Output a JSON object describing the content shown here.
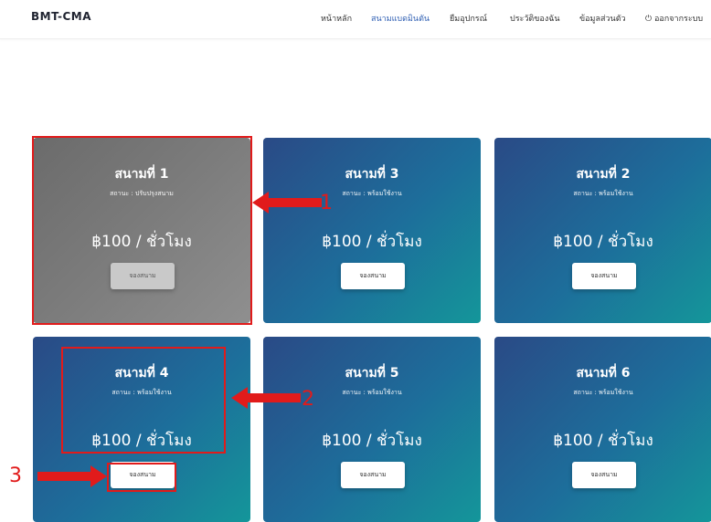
{
  "nav": {
    "brand": "BMT-CMA",
    "links": [
      {
        "label": "หน้าหลัก",
        "active": false
      },
      {
        "label": "สนามแบดมินตัน",
        "active": true
      },
      {
        "label": "ยืมอุปกรณ์",
        "active": false
      },
      {
        "label": "ประวัติของฉัน",
        "active": false
      },
      {
        "label": "ข้อมูลส่วนตัว",
        "active": false
      },
      {
        "label": "⏻ ออกจากระบบ",
        "active": false
      }
    ]
  },
  "courts": [
    {
      "name": "สนามที่ 1",
      "status": "สถานะ : ปรับปรุงสนาม",
      "price": "฿100 / ชั่วโมง",
      "button": "จองสนาม"
    },
    {
      "name": "สนามที่ 3",
      "status": "สถานะ : พร้อมใช้งาน",
      "price": "฿100 / ชั่วโมง",
      "button": "จองสนาม"
    },
    {
      "name": "สนามที่ 2",
      "status": "สถานะ : พร้อมใช้งาน",
      "price": "฿100 / ชั่วโมง",
      "button": "จองสนาม"
    },
    {
      "name": "สนามที่ 4",
      "status": "สถานะ : พร้อมใช้งาน",
      "price": "฿100 / ชั่วโมง",
      "button": "จองสนาม"
    },
    {
      "name": "สนามที่ 5",
      "status": "สถานะ : พร้อมใช้งาน",
      "price": "฿100 / ชั่วโมง",
      "button": "จองสนาม"
    },
    {
      "name": "สนามที่ 6",
      "status": "สถานะ : พร้อมใช้งาน",
      "price": "฿100 / ชั่วโมง",
      "button": "จองสนาม"
    }
  ],
  "annotations": {
    "one": "1",
    "two": "2",
    "three": "3"
  },
  "colors": {
    "accent": "#2f5fb3",
    "annotation": "#e11b1b",
    "maintenance_card": "#7a7a7a",
    "card_gradient_start": "#2a4a86",
    "card_gradient_end": "#14969a"
  }
}
